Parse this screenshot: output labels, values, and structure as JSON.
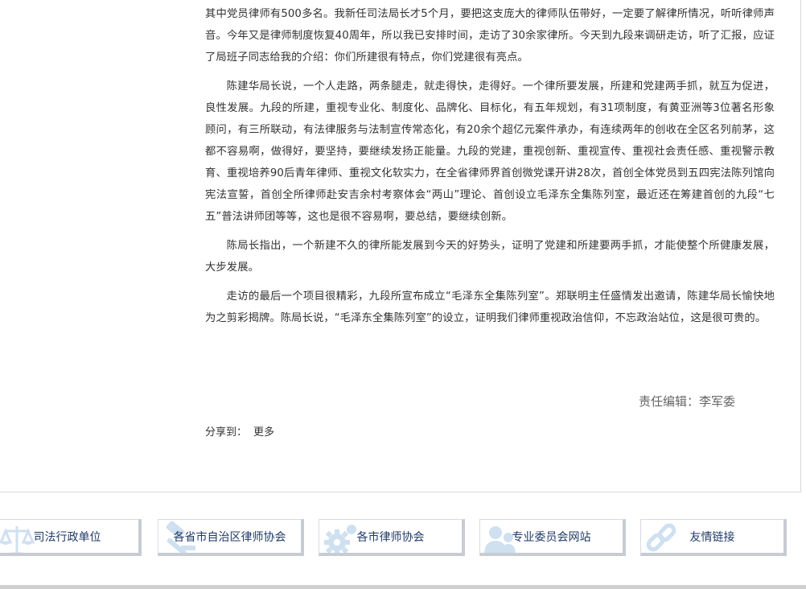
{
  "article": {
    "paragraphs": [
      "其中党员律师有500多名。我新任司法局长才5个月，要把这支庞大的律师队伍带好，一定要了解律所情况，听听律师声音。今年又是律师制度恢复40周年，所以我已安排时间，走访了30余家律所。今天到九段来调研走访，听了汇报，应证了局班子同志给我的介绍：你们所建很有特点，你们党建很有亮点。",
      "陈建华局长说，一个人走路，两条腿走，就走得快，走得好。一个律所要发展，所建和党建两手抓，就互为促进，良性发展。九段的所建，重视专业化、制度化、品牌化、目标化，有五年规划，有31项制度，有黄亚洲等3位著名形象顾问，有三所联动，有法律服务与法制宣传常态化，有20余个超亿元案件承办，有连续两年的创收在全区名列前茅，这都不容易啊，做得好，要坚持，要继续发扬正能量。九段的党建，重视创新、重视宣传、重视社会责任感、重视警示教育、重视培养90后青年律师、重视文化软实力，在全省律师界首创微党课开讲28次，首创全体党员到五四宪法陈列馆向宪法宣誓，首创全所律师赴安吉余村考察体会“两山”理论、首创设立毛泽东全集陈列室，最近还在筹建首创的九段“七五”普法讲师团等等，这也是很不容易啊，要总结，要继续创新。",
      "陈局长指出，一个新建不久的律所能发展到今天的好势头，证明了党建和所建要两手抓，才能使整个所健康发展，大步发展。",
      "走访的最后一个项目很精彩，九段所宣布成立“毛泽东全集陈列室”。郑联明主任盛情发出邀请，陈建华局长愉快地为之剪彩揭牌。陈局长说，“毛泽东全集陈列室”的设立，证明我们律师重视政治信仰，不忘政治站位，这是很可贵的。"
    ],
    "editor": "责任编辑：李军委",
    "share_label": "分享到：",
    "share_more": "更多"
  },
  "links": [
    {
      "label": "司法行政单位",
      "icon": "scales-icon"
    },
    {
      "label": "各省市自治区律师协会",
      "icon": "gavel-icon"
    },
    {
      "label": "各市律师协会",
      "icon": "gear-icon"
    },
    {
      "label": "专业委员会网站",
      "icon": "people-icon"
    },
    {
      "label": "友情链接",
      "icon": "link-chain-icon"
    }
  ],
  "colors": {
    "link_text": "#1f3a66",
    "icon_tint": "#cfe0f0",
    "body_text": "#333333"
  }
}
